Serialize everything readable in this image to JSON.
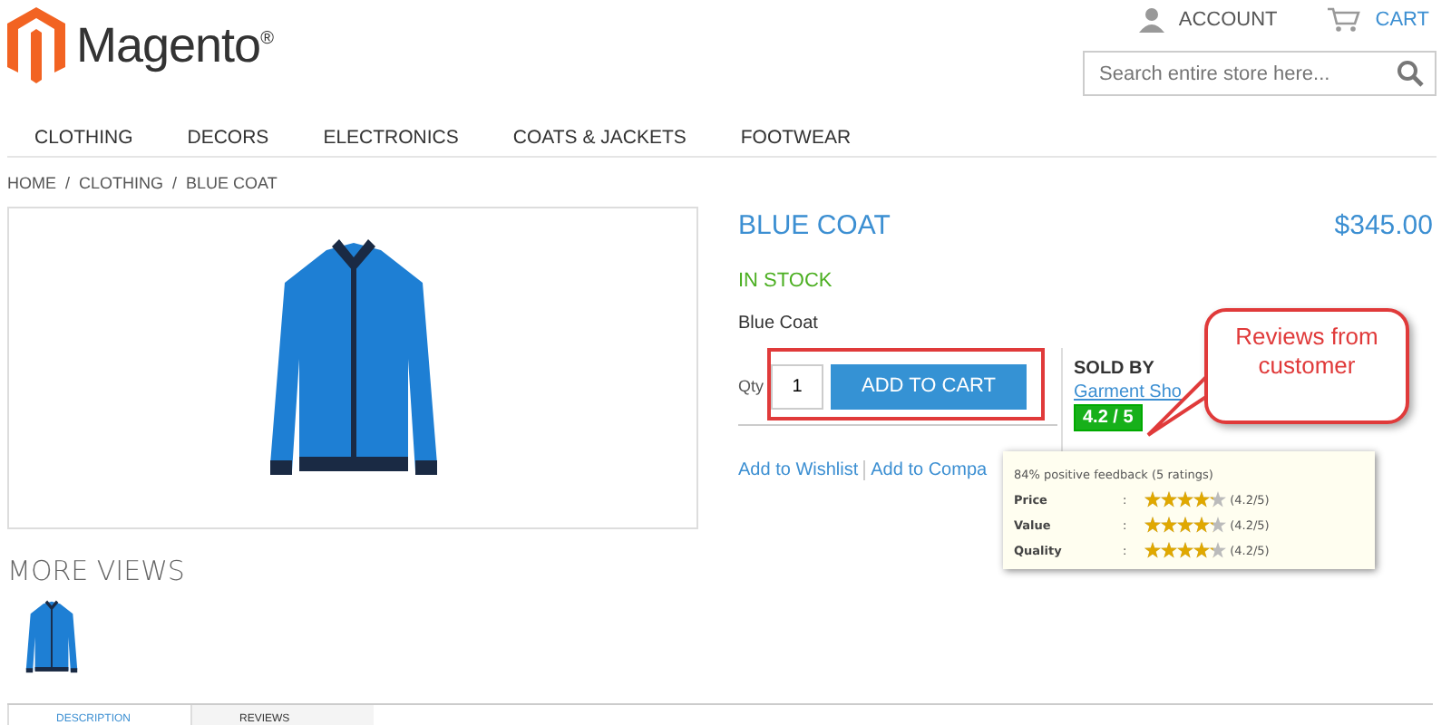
{
  "header": {
    "logo": "Magento",
    "logo_mark": "®",
    "account": "ACCOUNT",
    "cart": "CART",
    "search": {
      "placeholder": "Search entire store here..."
    }
  },
  "nav": [
    "CLOTHING",
    "DECORS",
    "ELECTRONICS",
    "COATS & JACKETS",
    "FOOTWEAR"
  ],
  "breadcrumb": [
    "HOME",
    "/",
    "CLOTHING",
    "/",
    "BLUE COAT"
  ],
  "product": {
    "title": "BLUE COAT",
    "price": "$345.00",
    "stock": "IN STOCK",
    "name": "Blue Coat",
    "qty_label": "Qty",
    "qty": "1",
    "add_button": "ADD TO CART",
    "links": [
      "Add to Wishlist",
      "Add to Compa"
    ]
  },
  "seller": {
    "heading": "SOLD BY",
    "name": "Garment Sho",
    "score": "4.2 / 5"
  },
  "callout": {
    "text": "Reviews from customer"
  },
  "feedback": {
    "summary": "84% positive feedback (5 ratings)",
    "ratings": [
      {
        "label": "Price",
        "sep": ":",
        "stars": 4.2,
        "value": "(4.2/5)"
      },
      {
        "label": "Value",
        "sep": ":",
        "stars": 4.2,
        "value": "(4.2/5)"
      },
      {
        "label": "Quality",
        "sep": ":",
        "stars": 4.2,
        "value": "(4.2/5)"
      }
    ]
  },
  "more_views": {
    "heading": "MORE VIEWS"
  },
  "tabs": [
    {
      "label": "DESCRIPTION",
      "selected": true
    },
    {
      "label": "REVIEWS",
      "selected": false
    }
  ]
}
